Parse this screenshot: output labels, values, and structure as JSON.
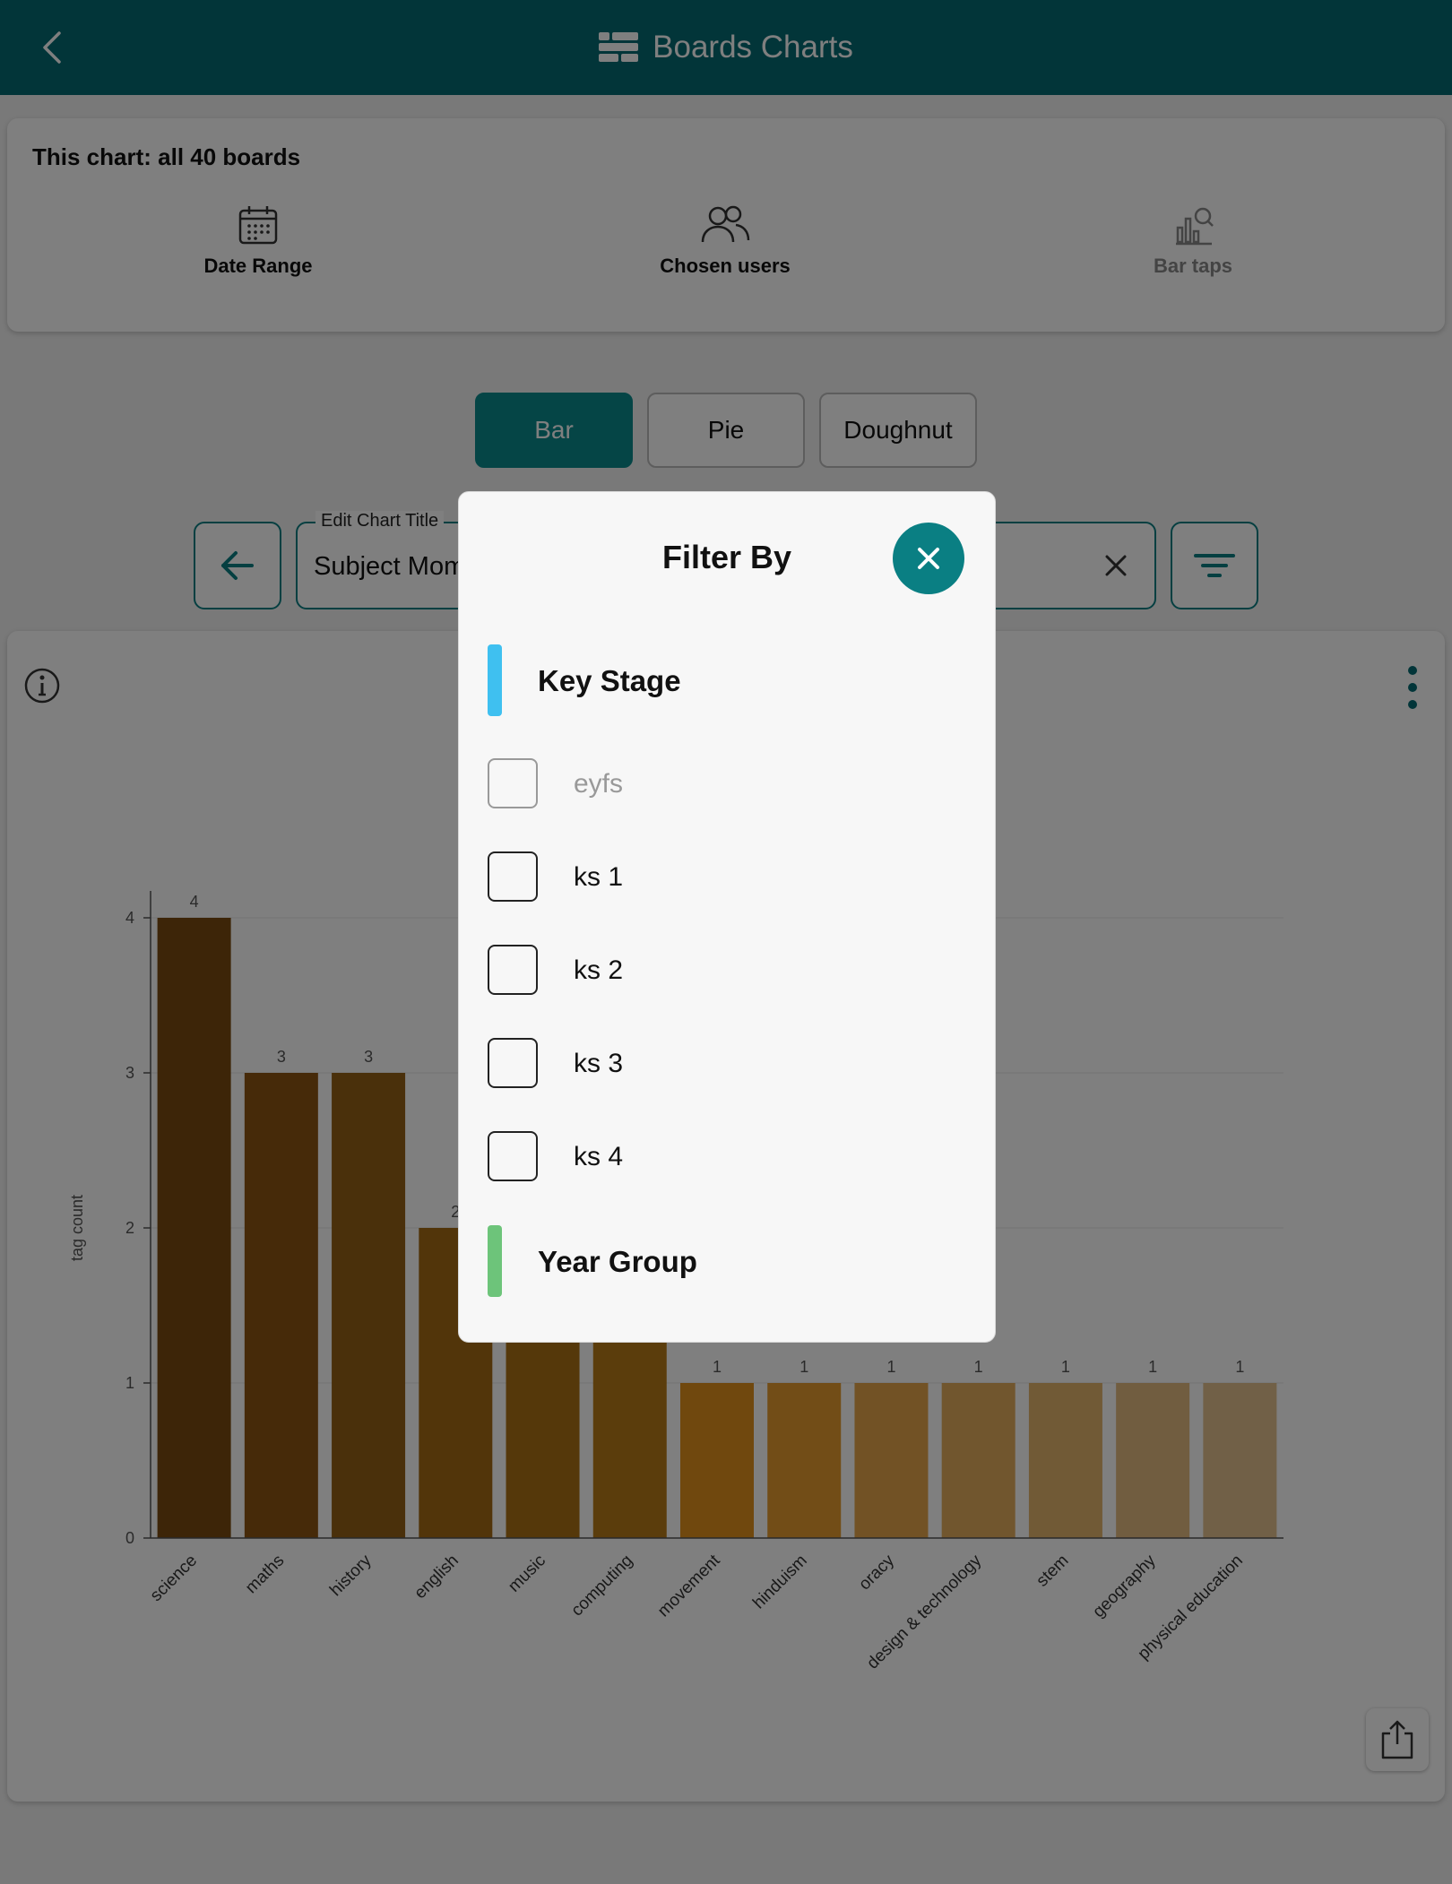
{
  "header": {
    "title": "Boards Charts"
  },
  "summary": {
    "title": "This chart: all 40 boards",
    "items": [
      {
        "label": "Date Range",
        "icon": "calendar-icon"
      },
      {
        "label": "Chosen users",
        "icon": "users-icon"
      },
      {
        "label": "Bar taps",
        "icon": "bar-search-icon"
      }
    ]
  },
  "chart_types": {
    "bar": "Bar",
    "pie": "Pie",
    "doughnut": "Doughnut"
  },
  "title_field": {
    "label": "Edit Chart Title",
    "value": "Subject Mom"
  },
  "chart_data": {
    "type": "bar",
    "categories": [
      "science",
      "maths",
      "history",
      "english",
      "music",
      "computing",
      "movement",
      "hinduism",
      "oracy",
      "design & technology",
      "stem",
      "geography",
      "physical education"
    ],
    "values": [
      4,
      3,
      3,
      2,
      2,
      2,
      1,
      1,
      1,
      1,
      1,
      1,
      1
    ],
    "data_labels": [
      "4",
      "3",
      "3",
      "2",
      "",
      "",
      "1",
      "1",
      "1",
      "1",
      "1",
      "1",
      "1"
    ],
    "ylabel": "tag count",
    "ylim": [
      0,
      4
    ],
    "yticks": [
      "0",
      "1",
      "2",
      "3",
      "4"
    ],
    "grid": true,
    "bar_colors": [
      "#7a4a10",
      "#8d5512",
      "#946016",
      "#a46a14",
      "#ab7014",
      "#b77a18",
      "#e0901c",
      "#e59a2e",
      "#e4a44a",
      "#e3ad5c",
      "#e3b56c",
      "#e3bb80",
      "#e3c08e"
    ]
  },
  "modal": {
    "title": "Filter By",
    "sections": [
      {
        "label": "Key Stage",
        "color": "#3fc0f0"
      },
      {
        "label": "Year Group",
        "color": "#6dc47a"
      }
    ],
    "options": [
      {
        "label": "eyfs",
        "disabled": true
      },
      {
        "label": "ks 1",
        "disabled": false
      },
      {
        "label": "ks 2",
        "disabled": false
      },
      {
        "label": "ks 3",
        "disabled": false
      },
      {
        "label": "ks 4",
        "disabled": false
      }
    ]
  }
}
